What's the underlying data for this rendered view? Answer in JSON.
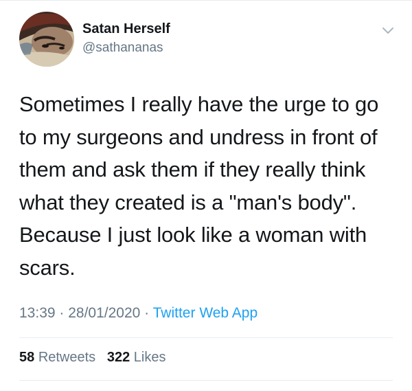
{
  "user": {
    "display_name": "Satan Herself",
    "handle": "@sathananas"
  },
  "tweet": {
    "text": "Sometimes I really have the urge to go\nto my surgeons and undress in front of\nthem and ask them if they really think\nwhat they created is a \"man's body\".\nBecause I just look like a woman with\nscars."
  },
  "meta": {
    "time": "13:39",
    "separator": " · ",
    "date": "28/01/2020",
    "source": "Twitter Web App"
  },
  "stats": {
    "retweets_count": "58",
    "retweets_label": "Retweets",
    "likes_count": "322",
    "likes_label": "Likes"
  },
  "icons": {
    "menu": "chevron-down-icon"
  },
  "colors": {
    "text": "#14171a",
    "secondary": "#657786",
    "link": "#1da1f2",
    "divider": "#e6ecf0"
  }
}
